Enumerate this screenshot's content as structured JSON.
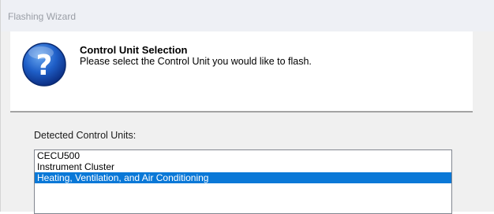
{
  "window": {
    "title": "Flashing Wizard"
  },
  "header": {
    "icon": "question-mark-icon",
    "heading": "Control Unit Selection",
    "subheading": "Please select the Control Unit you would like to flash."
  },
  "control_units": {
    "label": "Detected Control Units:",
    "items": [
      {
        "label": "CECU500",
        "selected": false
      },
      {
        "label": "Instrument Cluster",
        "selected": false
      },
      {
        "label": "Heating, Ventilation, and Air Conditioning",
        "selected": true
      }
    ],
    "selection_color": "#0a78d7"
  }
}
